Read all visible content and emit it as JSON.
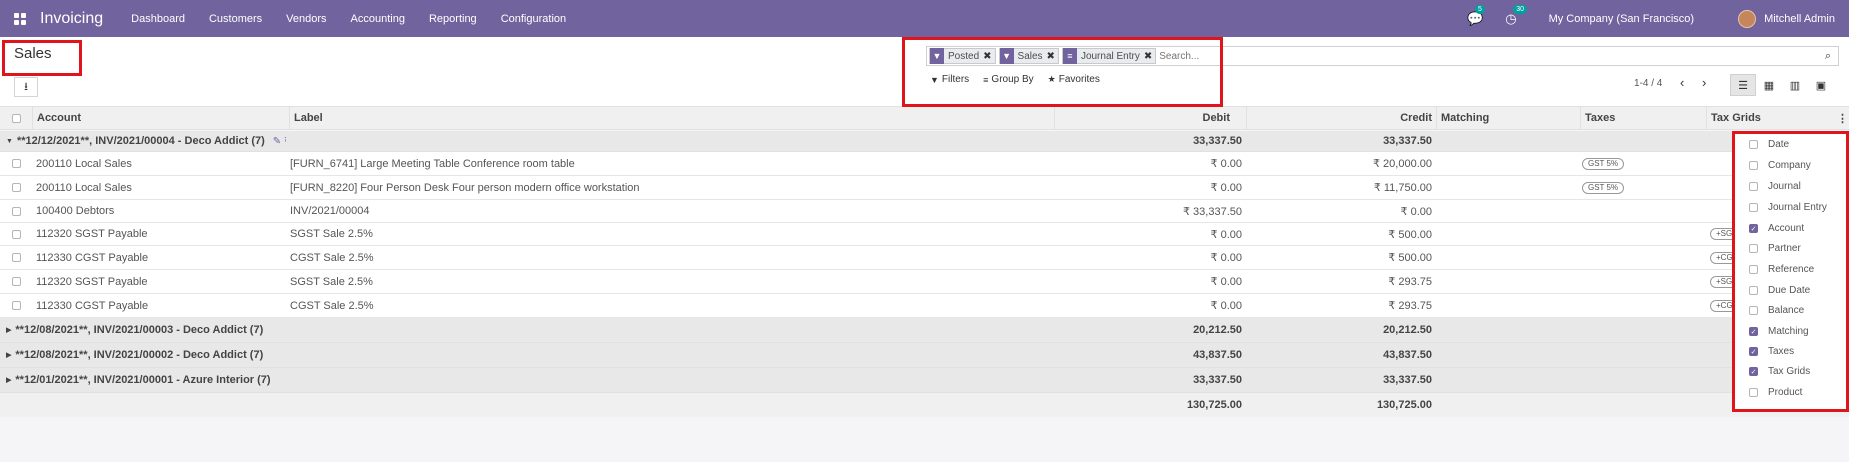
{
  "navbar": {
    "app_name": "Invoicing",
    "menu": [
      "Dashboard",
      "Customers",
      "Vendors",
      "Accounting",
      "Reporting",
      "Configuration"
    ],
    "messages_count": "5",
    "activities_count": "30",
    "company": "My Company (San Francisco)",
    "user": "Mitchell Admin"
  },
  "control": {
    "title": "Sales",
    "facets": [
      {
        "icon": "filter-icon",
        "label": "Posted"
      },
      {
        "icon": "filter-icon",
        "label": "Sales"
      },
      {
        "icon": "groupby-icon",
        "label": "Journal Entry"
      }
    ],
    "search_placeholder": "Search...",
    "filters_label": "Filters",
    "groupby_label": "Group By",
    "favorites_label": "Favorites",
    "pager": "1-4 / 4"
  },
  "table": {
    "headers": {
      "account": "Account",
      "label": "Label",
      "debit": "Debit",
      "credit": "Credit",
      "matching": "Matching",
      "taxes": "Taxes",
      "tax_grids": "Tax Grids"
    },
    "groups": [
      {
        "name": "**12/12/2021**, INV/2021/00004 - Deco Addict (7)",
        "debit": "33,337.50",
        "credit": "33,337.50"
      },
      {
        "name": "**12/08/2021**, INV/2021/00003 - Deco Addict (7)",
        "debit": "20,212.50",
        "credit": "20,212.50"
      },
      {
        "name": "**12/08/2021**, INV/2021/00002 - Deco Addict (7)",
        "debit": "43,837.50",
        "credit": "43,837.50"
      },
      {
        "name": "**12/01/2021**, INV/2021/00001 - Azure Interior (7)",
        "debit": "33,337.50",
        "credit": "33,337.50"
      }
    ],
    "lines": [
      {
        "account": "200110 Local Sales",
        "label": "[FURN_6741] Large Meeting Table Conference room table",
        "debit": "₹ 0.00",
        "credit": "₹ 20,000.00",
        "tax": "GST 5%",
        "grid": ""
      },
      {
        "account": "200110 Local Sales",
        "label": "[FURN_8220] Four Person Desk Four person modern office workstation",
        "debit": "₹ 0.00",
        "credit": "₹ 11,750.00",
        "tax": "GST 5%",
        "grid": ""
      },
      {
        "account": "100400 Debtors",
        "label": "INV/2021/00004",
        "debit": "₹ 33,337.50",
        "credit": "₹ 0.00",
        "tax": "",
        "grid": ""
      },
      {
        "account": "112320 SGST Payable",
        "label": "SGST Sale 2.5%",
        "debit": "₹ 0.00",
        "credit": "₹ 500.00",
        "tax": "",
        "grid": "+SG"
      },
      {
        "account": "112330 CGST Payable",
        "label": "CGST Sale 2.5%",
        "debit": "₹ 0.00",
        "credit": "₹ 500.00",
        "tax": "",
        "grid": "+CG"
      },
      {
        "account": "112320 SGST Payable",
        "label": "SGST Sale 2.5%",
        "debit": "₹ 0.00",
        "credit": "₹ 293.75",
        "tax": "",
        "grid": "+SG"
      },
      {
        "account": "112330 CGST Payable",
        "label": "CGST Sale 2.5%",
        "debit": "₹ 0.00",
        "credit": "₹ 293.75",
        "tax": "",
        "grid": "+CG"
      }
    ],
    "totals": {
      "debit": "130,725.00",
      "credit": "130,725.00"
    }
  },
  "optional_columns": [
    {
      "label": "Date",
      "checked": false
    },
    {
      "label": "Company",
      "checked": false
    },
    {
      "label": "Journal",
      "checked": false
    },
    {
      "label": "Journal Entry",
      "checked": false
    },
    {
      "label": "Account",
      "checked": true
    },
    {
      "label": "Partner",
      "checked": false
    },
    {
      "label": "Reference",
      "checked": false
    },
    {
      "label": "Due Date",
      "checked": false
    },
    {
      "label": "Balance",
      "checked": false
    },
    {
      "label": "Matching",
      "checked": true
    },
    {
      "label": "Taxes",
      "checked": true
    },
    {
      "label": "Tax Grids",
      "checked": true
    },
    {
      "label": "Product",
      "checked": false
    }
  ],
  "colors": {
    "brand": "#71639e",
    "highlight": "#e0151c",
    "badge": "#00a09d"
  }
}
